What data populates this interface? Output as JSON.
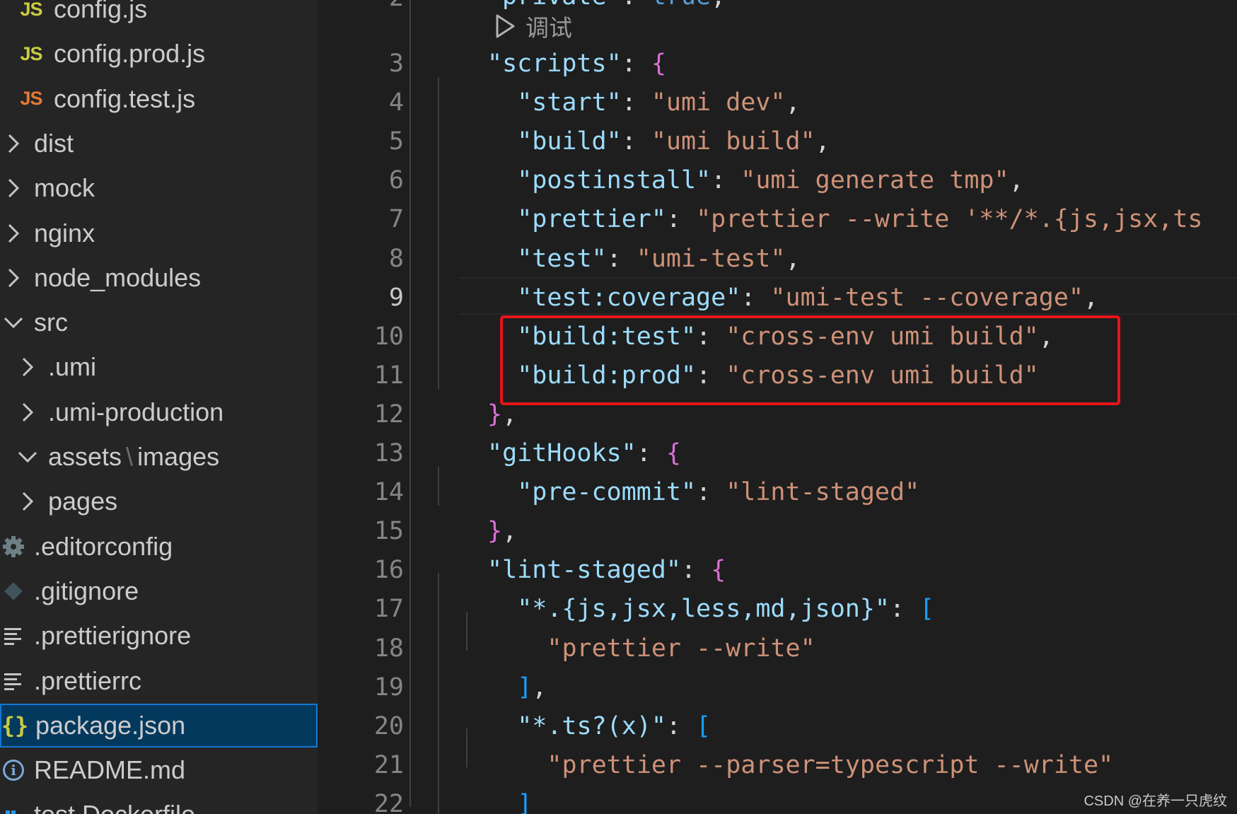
{
  "explorer": {
    "items": [
      {
        "label": "config.js",
        "icon": "js-file-icon",
        "depth": 1
      },
      {
        "label": "config.prod.js",
        "icon": "js-file-icon",
        "depth": 1
      },
      {
        "label": "config.test.js",
        "icon": "js-file-icon",
        "depth": 1
      },
      {
        "label": "dist",
        "icon": "chevron-right-icon",
        "depth": 0
      },
      {
        "label": "mock",
        "icon": "chevron-right-icon",
        "depth": 0
      },
      {
        "label": "nginx",
        "icon": "chevron-right-icon",
        "depth": 0
      },
      {
        "label": "node_modules",
        "icon": "chevron-right-icon",
        "depth": 0
      },
      {
        "label": "src",
        "icon": "chevron-down-icon",
        "depth": 0
      },
      {
        "label": ".umi",
        "icon": "chevron-right-icon",
        "depth": 1
      },
      {
        "label": ".umi-production",
        "icon": "chevron-right-icon",
        "depth": 1
      },
      {
        "label": "assets",
        "label2": "images",
        "separator": "\\",
        "icon": "chevron-down-icon",
        "depth": 1
      },
      {
        "label": "pages",
        "icon": "chevron-right-icon",
        "depth": 1
      },
      {
        "label": ".editorconfig",
        "icon": "gear-icon",
        "depth": 0
      },
      {
        "label": ".gitignore",
        "icon": "git-icon",
        "depth": 0
      },
      {
        "label": ".prettierignore",
        "icon": "lines-icon",
        "depth": 0
      },
      {
        "label": ".prettierrc",
        "icon": "lines-icon",
        "depth": 0
      },
      {
        "label": "package.json",
        "icon": "json-file-icon",
        "depth": 0,
        "selected": true
      },
      {
        "label": "README.md",
        "icon": "info-icon",
        "depth": 0
      },
      {
        "label": "test.Dockerfile",
        "icon": "docker-icon",
        "depth": 0
      }
    ]
  },
  "editor": {
    "codelens": "调试",
    "active_line": 9,
    "highlighted_lines": [
      10,
      11
    ],
    "partial_top_line": {
      "number": "2",
      "text": "  \"private\": true,"
    },
    "lines": [
      {
        "n": 3,
        "indent": 1,
        "key": "\"scripts\"",
        "open": "{",
        "depth": 1
      },
      {
        "n": 4,
        "indent": 2,
        "key": "\"start\"",
        "value": "\"umi dev\"",
        "comma": true
      },
      {
        "n": 5,
        "indent": 2,
        "key": "\"build\"",
        "value": "\"umi build\"",
        "comma": true
      },
      {
        "n": 6,
        "indent": 2,
        "key": "\"postinstall\"",
        "value": "\"umi generate tmp\"",
        "comma": true
      },
      {
        "n": 7,
        "indent": 2,
        "key": "\"prettier\"",
        "value": "\"prettier --write '**/*.{js,jsx,ts",
        "comma": false
      },
      {
        "n": 8,
        "indent": 2,
        "key": "\"test\"",
        "value": "\"umi-test\"",
        "comma": true
      },
      {
        "n": 9,
        "indent": 2,
        "key": "\"test:coverage\"",
        "value": "\"umi-test --coverage\"",
        "comma": true
      },
      {
        "n": 10,
        "indent": 2,
        "key": "\"build:test\"",
        "value": "\"cross-env umi build\"",
        "comma": true
      },
      {
        "n": 11,
        "indent": 2,
        "key": "\"build:prod\"",
        "value": "\"cross-env umi build\"",
        "comma": false
      },
      {
        "n": 12,
        "indent": 1,
        "close": "}",
        "depth": 1,
        "comma": true
      },
      {
        "n": 13,
        "indent": 1,
        "key": "\"gitHooks\"",
        "open": "{",
        "depth": 1
      },
      {
        "n": 14,
        "indent": 2,
        "key": "\"pre-commit\"",
        "value": "\"lint-staged\"",
        "comma": false
      },
      {
        "n": 15,
        "indent": 1,
        "close": "}",
        "depth": 1,
        "comma": true
      },
      {
        "n": 16,
        "indent": 1,
        "key": "\"lint-staged\"",
        "open": "{",
        "depth": 1
      },
      {
        "n": 17,
        "indent": 2,
        "key": "\"*.{js,jsx,less,md,json}\"",
        "open": "[",
        "depth": 2
      },
      {
        "n": 18,
        "indent": 3,
        "value": "\"prettier --write\"",
        "comma": false
      },
      {
        "n": 19,
        "indent": 2,
        "close": "]",
        "depth": 2,
        "comma": true
      },
      {
        "n": 20,
        "indent": 2,
        "key": "\"*.ts?(x)\"",
        "open": "[",
        "depth": 2
      },
      {
        "n": 21,
        "indent": 3,
        "value": "\"prettier --parser=typescript --write\"",
        "comma": false
      },
      {
        "n": 22,
        "indent": 2,
        "close": "]",
        "depth": 2,
        "comma": false
      }
    ]
  },
  "watermark": "CSDN @在养一只虎纹",
  "colors": {
    "sidebar_bg": "#252526",
    "editor_bg": "#1e1e1e",
    "selection_bg": "#04395e",
    "selection_border": "#1277d3",
    "json_key": "#9cdcfe",
    "json_string": "#ce9178",
    "bracket_depth1": "#da70d6",
    "bracket_depth2": "#179fff",
    "highlight_box": "#e8141a"
  }
}
